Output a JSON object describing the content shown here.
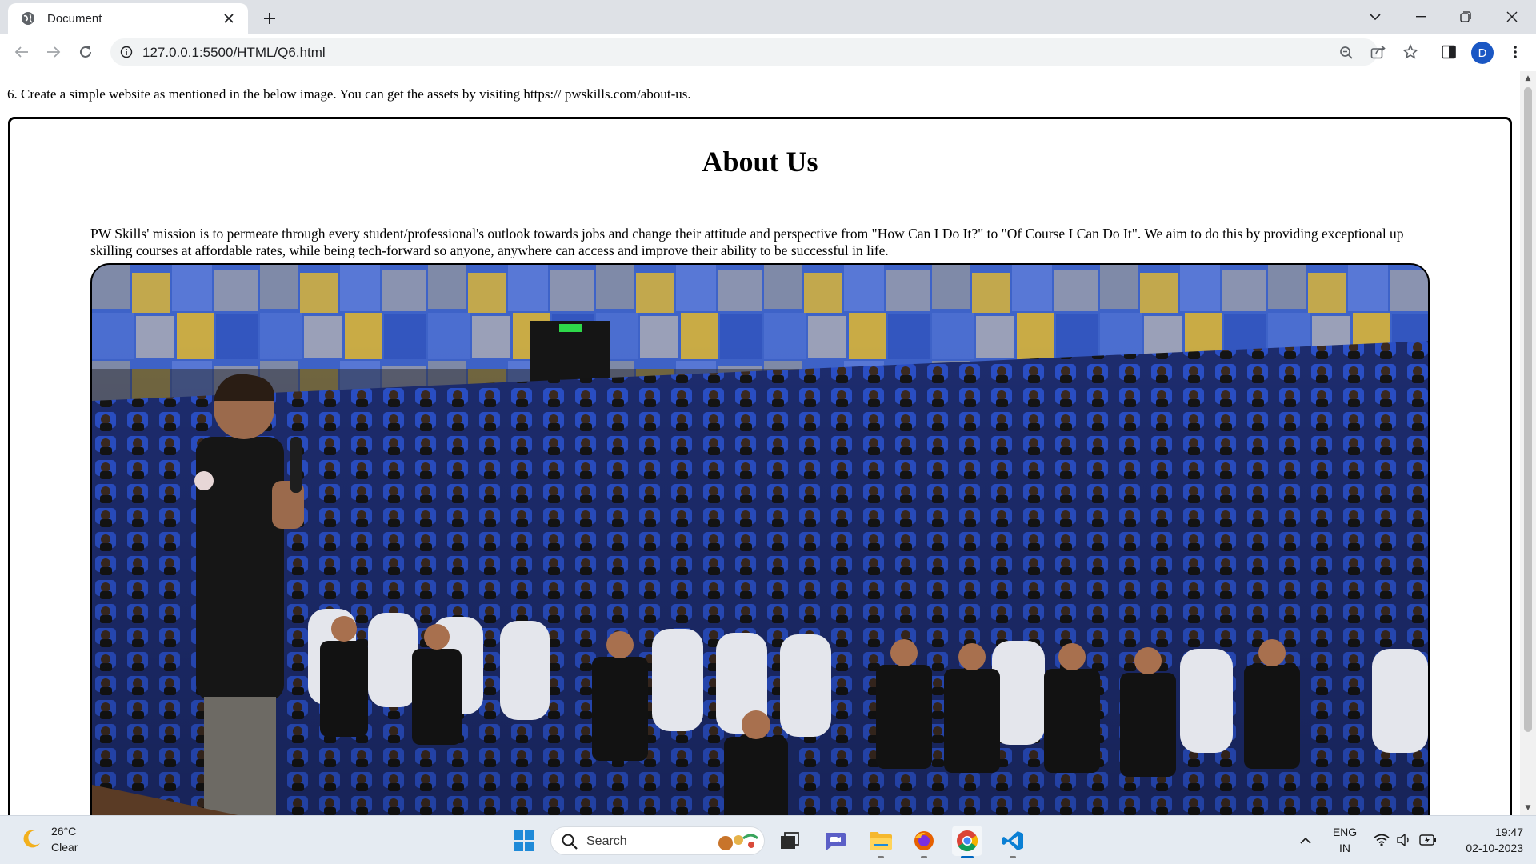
{
  "browser": {
    "tab_title": "Document",
    "url": "127.0.0.1:5500/HTML/Q6.html",
    "profile_initial": "D"
  },
  "page": {
    "question": "6. Create a simple website as mentioned in the below image. You can get the assets by visiting https:// pwskills.com/about-us.",
    "heading": "About Us",
    "mission": "PW Skills' mission is to permeate through every student/professional's outlook towards jobs and change their attitude and perspective from \"How Can I Do It?\" to \"Of Course I Can Do It\". We aim to do this by providing exceptional up skilling courses at affordable rates, while being tech-forward so anyone, anywhere can access and improve their ability to be successful in life."
  },
  "taskbar": {
    "weather_temp": "26°C",
    "weather_condition": "Clear",
    "search_label": "Search",
    "lang_top": "ENG",
    "lang_bottom": "IN",
    "time": "19:47",
    "date": "02-10-2023"
  },
  "icons": {
    "tab_favicon": "globe-icon",
    "back": "arrow-left-icon",
    "forward": "arrow-right-icon",
    "reload": "reload-icon",
    "site_info": "info-icon",
    "zoom": "zoom-icon",
    "share": "share-icon",
    "bookmark": "star-icon",
    "side_panel": "side-panel-icon",
    "menu": "kebab-menu-icon"
  },
  "colors": {
    "accent": "#0067c0",
    "profile": "#1a57c4"
  }
}
